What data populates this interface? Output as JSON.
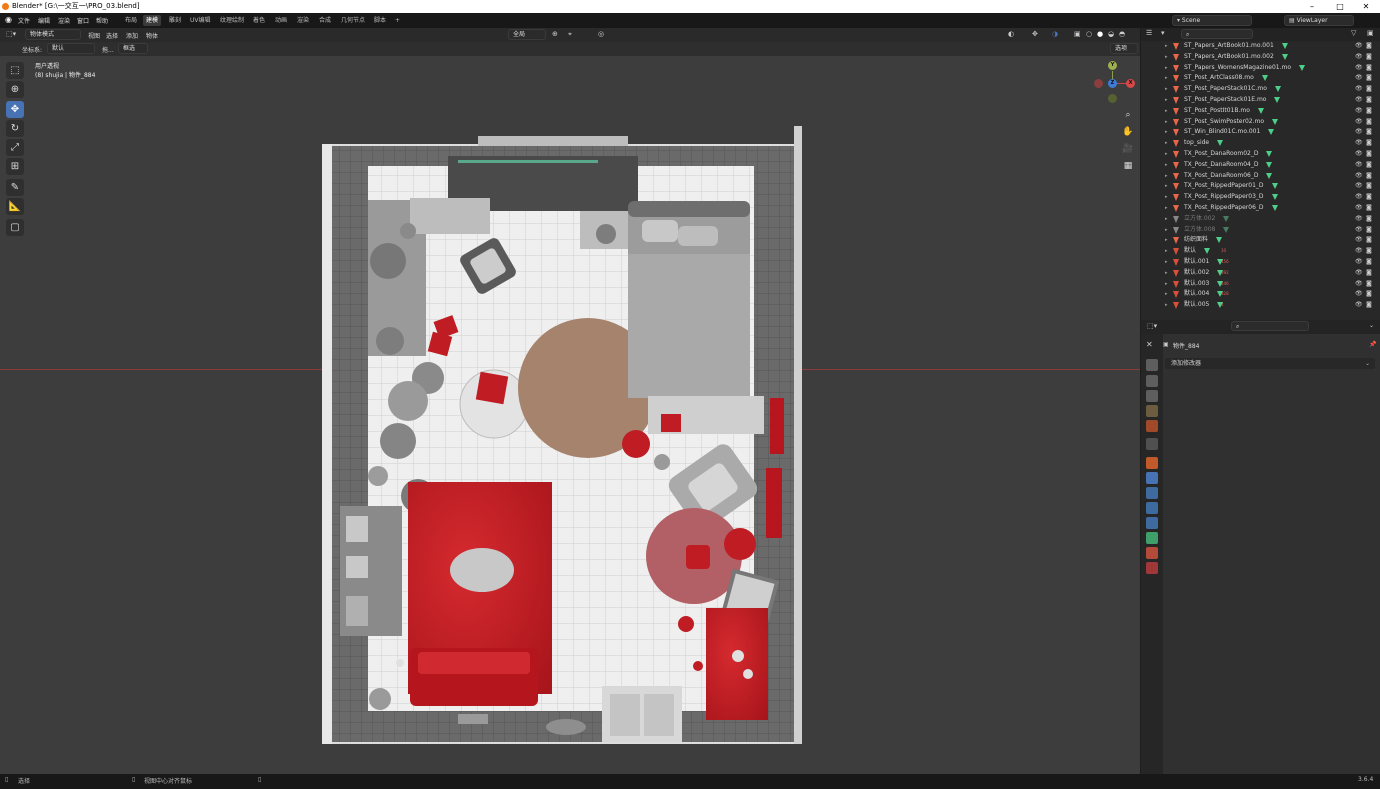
{
  "title_bar": {
    "title": "Blender* [G:\\一交互一\\PRO_03.blend]"
  },
  "top_menu": [
    "文件",
    "编辑",
    "渲染",
    "窗口",
    "帮助"
  ],
  "workspaces": [
    "布局",
    "建模",
    "雕刻",
    "UV编辑",
    "纹理绘制",
    "着色",
    "动画",
    "渲染",
    "合成",
    "几何节点",
    "脚本"
  ],
  "active_workspace": "建模",
  "workspace_add": "+",
  "scene": {
    "name": "Scene",
    "view_layer": "ViewLayer"
  },
  "viewport_header": {
    "mode": "物体模式",
    "menus": [
      "视图",
      "选择",
      "添加",
      "物体"
    ],
    "transform_global": "全局",
    "options_label": "选项"
  },
  "viewport_header2": {
    "coord_label": "坐标系:",
    "coord_value": "默认",
    "drag_label": "拖...",
    "select_mode": "框选"
  },
  "viewport_info": {
    "view_name": "用户透视",
    "object_info": "(8) shujia | 物件_884"
  },
  "gizmo": {
    "y": "Y",
    "x": "X",
    "z": "Z"
  },
  "outliner_items": [
    {
      "name": "ST_Papers_ArtBook01.mo.001",
      "type": "mesh"
    },
    {
      "name": "ST_Papers_ArtBook01.mo.002",
      "type": "mesh"
    },
    {
      "name": "ST_Papers_WomensMagazine01.mo",
      "type": "mesh"
    },
    {
      "name": "ST_Post_ArtClass08.mo",
      "type": "mesh"
    },
    {
      "name": "ST_Post_PaperStack01C.mo",
      "type": "mesh"
    },
    {
      "name": "ST_Post_PaperStack01E.mo",
      "type": "mesh"
    },
    {
      "name": "ST_Post_PostIt01B.mo",
      "type": "mesh"
    },
    {
      "name": "ST_Post_SwimPoster02.mo",
      "type": "mesh"
    },
    {
      "name": "ST_Win_Blind01C.mo.001",
      "type": "mesh"
    },
    {
      "name": "top_side",
      "type": "mesh"
    },
    {
      "name": "TX_Post_DanaRoom02_D",
      "type": "mesh"
    },
    {
      "name": "TX_Post_DanaRoom04_D",
      "type": "mesh"
    },
    {
      "name": "TX_Post_DanaRoom06_D",
      "type": "mesh"
    },
    {
      "name": "TX_Post_RippedPaper01_D",
      "type": "mesh"
    },
    {
      "name": "TX_Post_RippedPaper03_D",
      "type": "mesh"
    },
    {
      "name": "TX_Post_RippedPaper06_D",
      "type": "mesh"
    },
    {
      "name": "立方体.002",
      "type": "dim"
    },
    {
      "name": "立方体.008",
      "type": "dim"
    },
    {
      "name": "纺织面料",
      "type": "mesh"
    },
    {
      "name": "默认",
      "type": "armature",
      "badge": "10"
    },
    {
      "name": "默认.001",
      "type": "armature",
      "badge": "456"
    },
    {
      "name": "默认.002",
      "type": "armature",
      "badge": "392"
    },
    {
      "name": "默认.003",
      "type": "armature",
      "badge": "246"
    },
    {
      "name": "默认.004",
      "type": "armature",
      "badge": "328"
    },
    {
      "name": "默认.005",
      "type": "armature",
      "badge": "4"
    }
  ],
  "properties": {
    "object_name": "物件_884",
    "add_modifier": "添加修改器"
  },
  "status_bar": {
    "left": "选择",
    "middle": "视图中心对齐鼠标",
    "version": "3.6.4"
  },
  "colors": {
    "accent": "#4772b3",
    "viewport_bg": "#3d3d3d",
    "room_red": "#c01c24",
    "rug_tan": "#a5836d",
    "mesh_green": "#4dcf89"
  }
}
